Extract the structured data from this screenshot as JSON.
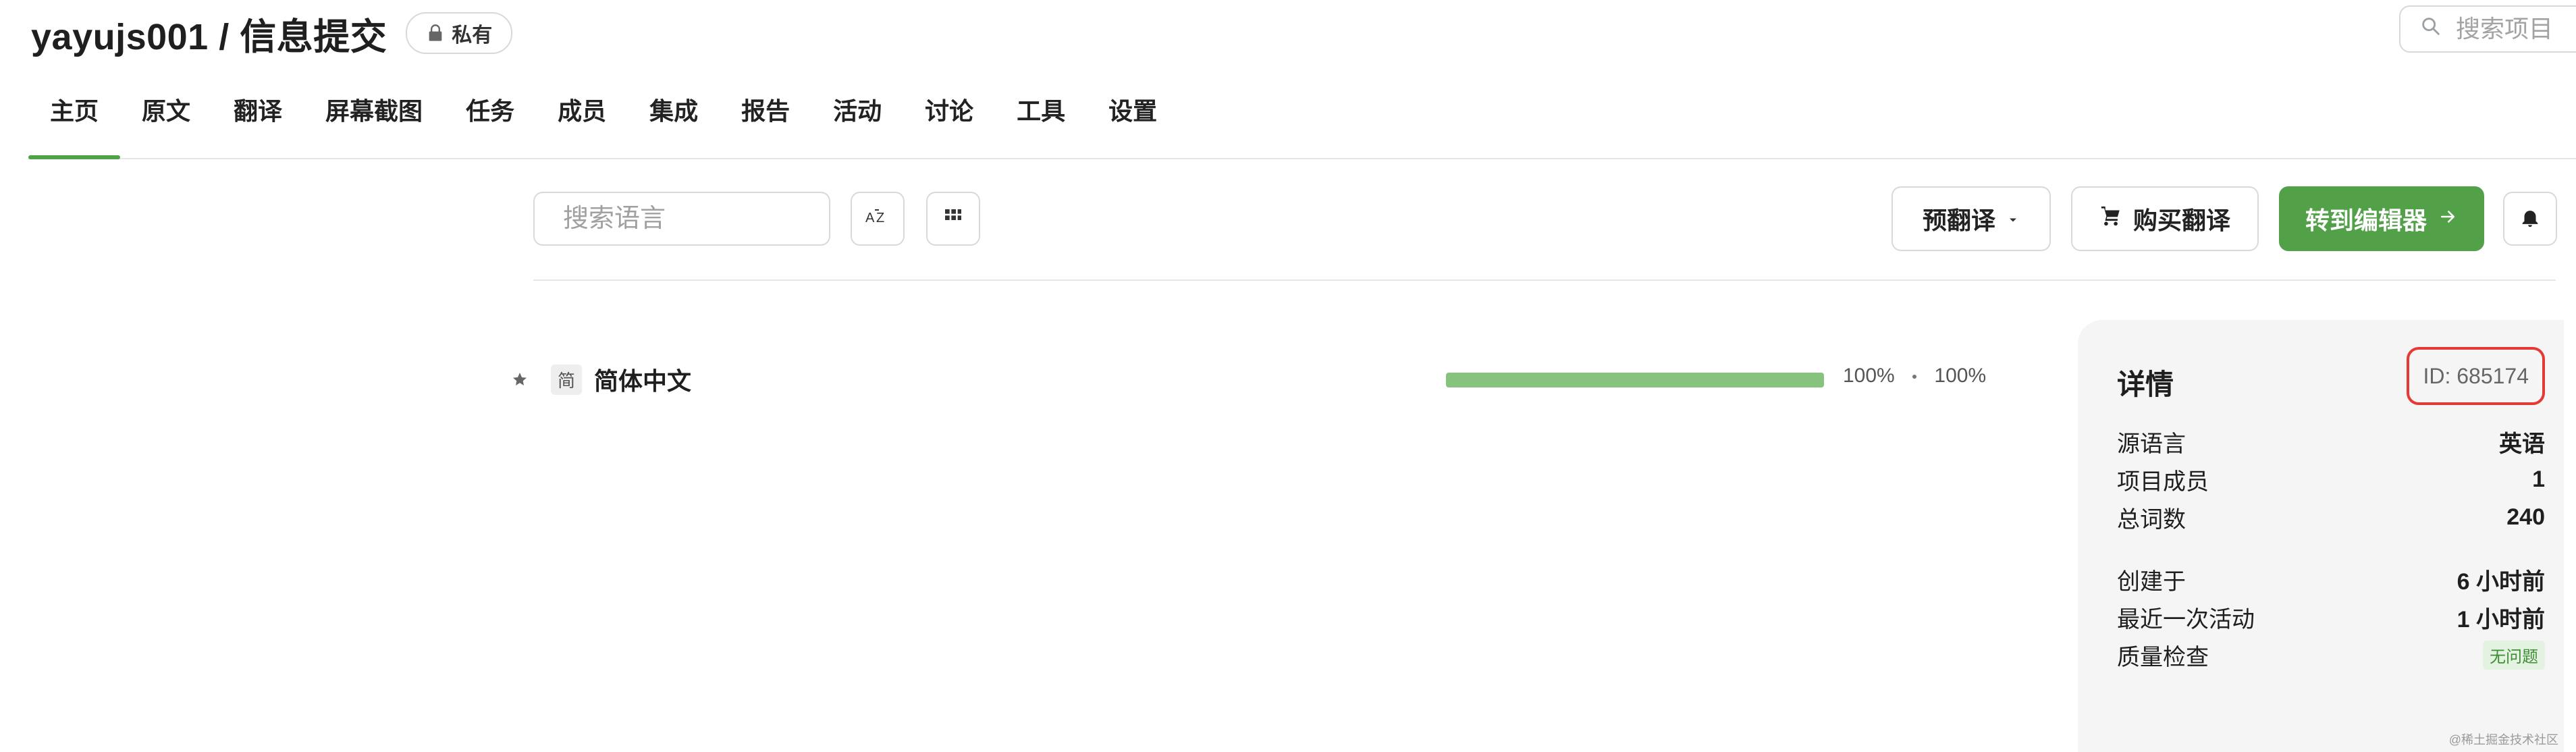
{
  "header": {
    "title": "yayujs001 / 信息提交",
    "badge": "私有",
    "search_placeholder": "搜索项目"
  },
  "tabs": [
    {
      "label": "主页",
      "active": true
    },
    {
      "label": "原文"
    },
    {
      "label": "翻译"
    },
    {
      "label": "屏幕截图"
    },
    {
      "label": "任务"
    },
    {
      "label": "成员"
    },
    {
      "label": "集成"
    },
    {
      "label": "报告"
    },
    {
      "label": "活动"
    },
    {
      "label": "讨论"
    },
    {
      "label": "工具"
    },
    {
      "label": "设置"
    }
  ],
  "toolbar": {
    "search_lang_placeholder": "搜索语言",
    "pretranslate": "预翻译",
    "buy_translation": "购买翻译",
    "goto_editor": "转到编辑器"
  },
  "languages": [
    {
      "abbr": "简",
      "name": "简体中文",
      "progress_value": 1.0,
      "progress_text_1": "100%",
      "progress_text_2": "100%"
    }
  ],
  "details": {
    "title": "详情",
    "id_text": "ID: 685174",
    "rows_1": [
      {
        "label": "源语言",
        "value": "英语"
      },
      {
        "label": "项目成员",
        "value": "1"
      },
      {
        "label": "总词数",
        "value": "240"
      }
    ],
    "rows_2": [
      {
        "label": "创建于",
        "value": "6 小时前"
      },
      {
        "label": "最近一次活动",
        "value": "1 小时前"
      },
      {
        "label": "质量检查",
        "value": "无问题"
      }
    ]
  },
  "watermark": "@稀土掘金技术社区",
  "colors": {
    "accent": "#52a148",
    "progress": "#86c47d",
    "highlight_border": "#e53935"
  }
}
